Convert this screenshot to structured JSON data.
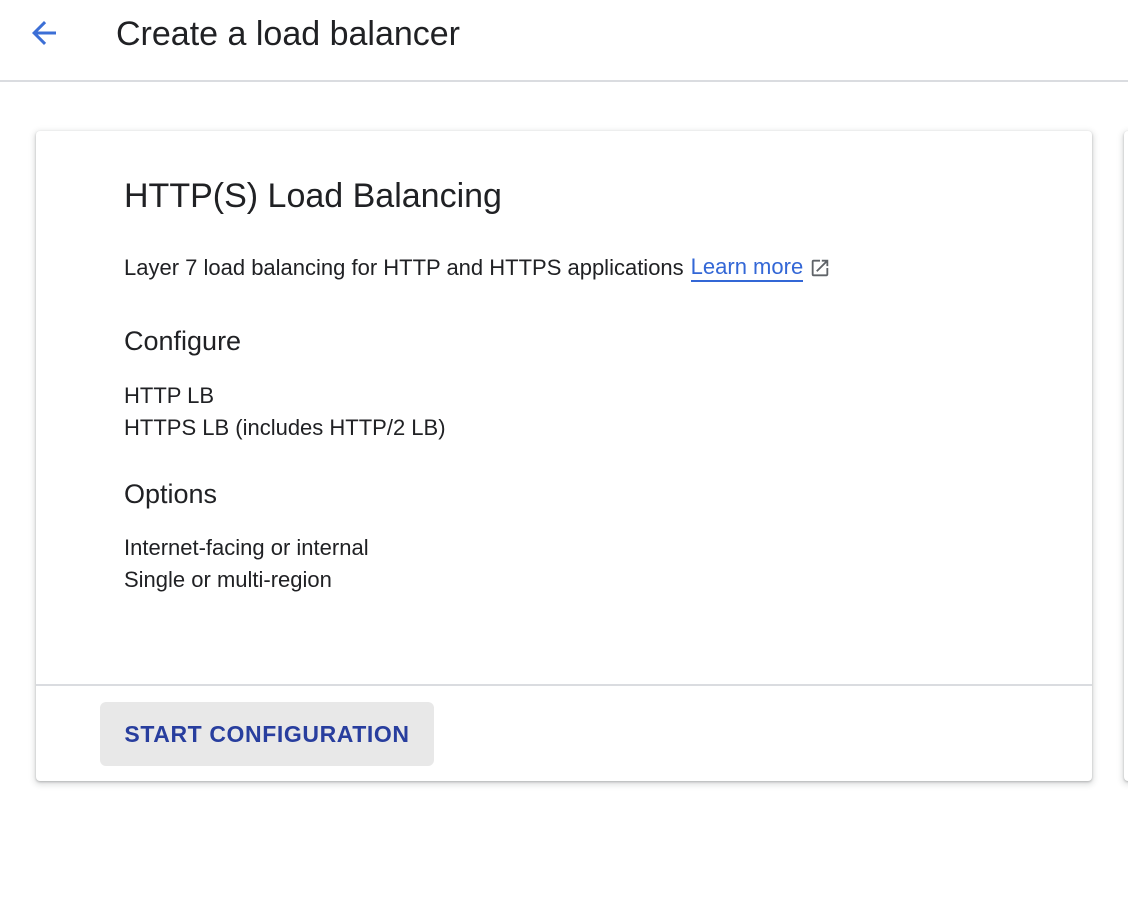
{
  "header": {
    "back_icon": "arrow-back-icon",
    "title": "Create a load balancer"
  },
  "card": {
    "title": "HTTP(S) Load Balancing",
    "description": "Layer 7 load balancing for HTTP and HTTPS applications",
    "learn_more_label": "Learn more",
    "external_icon": "open-in-new-icon",
    "configure": {
      "heading": "Configure",
      "items": [
        "HTTP LB",
        "HTTPS LB (includes HTTP/2 LB)"
      ]
    },
    "options": {
      "heading": "Options",
      "items": [
        "Internet-facing or internal",
        "Single or multi-region"
      ]
    },
    "start_button_label": "START CONFIGURATION"
  },
  "colors": {
    "accent": "#3367d6",
    "button_text": "#283e9e",
    "button_bg": "#e8e8e8",
    "divider": "#dadce0"
  }
}
